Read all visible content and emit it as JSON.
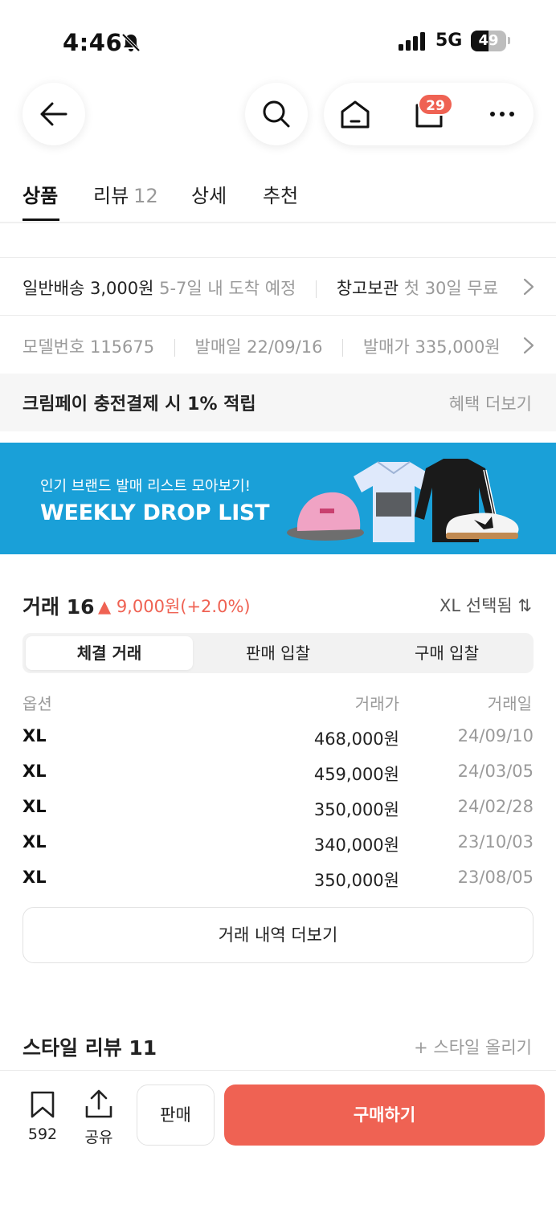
{
  "status_bar": {
    "time": "4:46",
    "network": "5G",
    "battery": "49",
    "battery_level_percent": 49,
    "icons": [
      "bell-slash-icon",
      "signal-icon",
      "battery-icon"
    ]
  },
  "nav": {
    "icons": [
      "back-arrow-icon",
      "search-icon",
      "home-icon",
      "bag-icon",
      "more-icon"
    ],
    "cart_badge": "29"
  },
  "tabs": [
    {
      "label": "상품",
      "count": ""
    },
    {
      "label": "리뷰",
      "count": "12"
    },
    {
      "label": "상세",
      "count": ""
    },
    {
      "label": "추천",
      "count": ""
    }
  ],
  "delivery": {
    "label": "일반배송",
    "fee": "3,000원",
    "eta": "5-7일 내 도착 예정",
    "storage_label": "창고보관",
    "storage_detail": "첫 30일 무료"
  },
  "product_info": {
    "model": "모델번호 115675",
    "release_date": "발매일 22/09/16",
    "release_price": "발매가 335,000원"
  },
  "benefit": {
    "title": "크림페이 충전결제 시 1% 적립",
    "link": "혜택 더보기"
  },
  "banner": {
    "subtitle": "인기 브랜드 발매 리스트 모아보기!",
    "title": "WEEKLY DROP LIST",
    "colors": {
      "background": "#1aa0d8"
    }
  },
  "trades": {
    "title": "거래 16",
    "change": "▲ 9,000원(+2.0%)",
    "size_selector": "XL 선택됨 ⇅",
    "segments": [
      "체결 거래",
      "판매 입찰",
      "구매 입찰"
    ],
    "active_segment": 0,
    "columns": [
      "옵션",
      "거래가",
      "거래일"
    ],
    "rows": [
      {
        "option": "XL",
        "price": "468,000원",
        "date": "24/09/10"
      },
      {
        "option": "XL",
        "price": "459,000원",
        "date": "24/03/05"
      },
      {
        "option": "XL",
        "price": "350,000원",
        "date": "24/02/28"
      },
      {
        "option": "XL",
        "price": "340,000원",
        "date": "23/10/03"
      },
      {
        "option": "XL",
        "price": "350,000원",
        "date": "23/08/05"
      }
    ],
    "more_label": "거래 내역 더보기"
  },
  "style_review": {
    "title": "스타일 리뷰 11",
    "link": "+ 스타일 올리기"
  },
  "bottom_bar": {
    "bookmark_count": "592",
    "share_label": "공유",
    "sell_label": "판매",
    "buy_label": "구매하기",
    "colors": {
      "accent": "#ef6253"
    }
  }
}
